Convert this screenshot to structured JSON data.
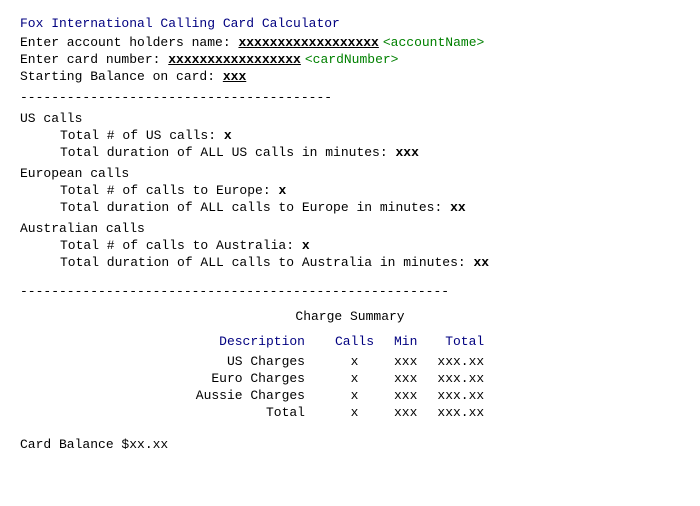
{
  "app": {
    "title": "Fox International Calling Card Calculator"
  },
  "form": {
    "account_label": "Enter account holders name: ",
    "account_value": "xxxxxxxxxxxxxxxxxx",
    "account_placeholder": "<accountName>",
    "card_label": "Enter card number: ",
    "card_value": "xxxxxxxxxxxxxxxxx",
    "card_placeholder": "<cardNumber>",
    "balance_label": "Starting Balance on card: ",
    "balance_value": "xxx"
  },
  "divider1": "----------------------------------------",
  "sections": {
    "us": {
      "title": "US calls",
      "calls_label": "Total # of US calls: ",
      "calls_value": "x",
      "duration_label": "Total duration of ALL US calls in minutes: ",
      "duration_value": "xxx"
    },
    "european": {
      "title": "European calls",
      "calls_label": "Total # of calls to Europe: ",
      "calls_value": "x",
      "duration_label": "Total duration of ALL calls to Europe in minutes: ",
      "duration_value": "xx"
    },
    "australian": {
      "title": "Australian calls",
      "calls_label": "Total # of calls to Australia: ",
      "calls_value": "x",
      "duration_label": "Total duration of ALL calls to Australia in minutes: ",
      "duration_value": "xx"
    }
  },
  "divider2": "-------------------------------------------------------",
  "summary": {
    "title": "Charge Summary",
    "headers": {
      "description": "Description",
      "calls": "Calls",
      "min": "Min",
      "total": "Total"
    },
    "rows": [
      {
        "label": "US Charges",
        "calls": "x",
        "min": "xxx",
        "total": "xxx.xx"
      },
      {
        "label": "Euro Charges",
        "calls": "x",
        "min": "xxx",
        "total": "xxx.xx"
      },
      {
        "label": "Aussie Charges",
        "calls": "x",
        "min": "xxx",
        "total": "xxx.xx"
      },
      {
        "label": "Total",
        "calls": "x",
        "min": "xxx",
        "total": "xxx.xx"
      }
    ]
  },
  "card_balance": {
    "label": "Card Balance $xx.xx"
  }
}
